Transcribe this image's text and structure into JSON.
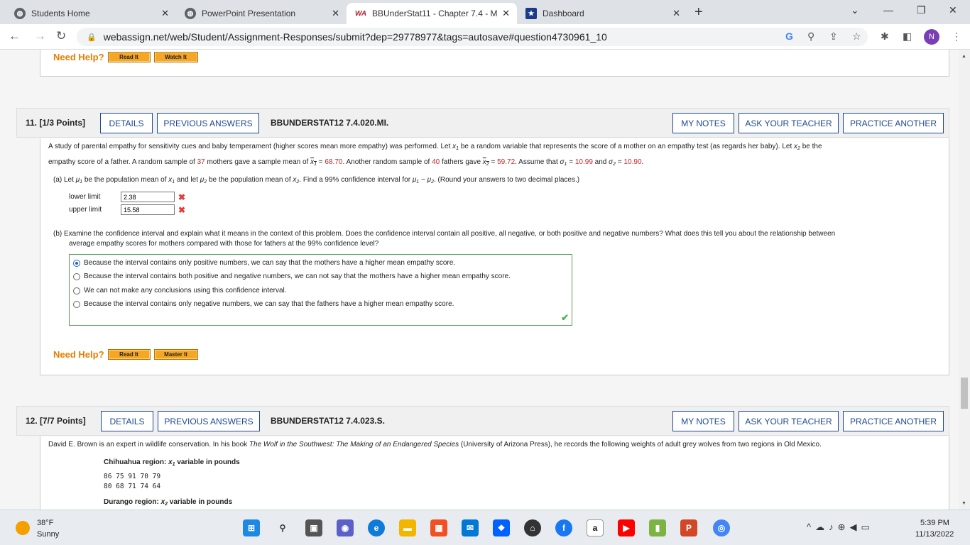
{
  "browser": {
    "tabs": [
      {
        "title": "Students Home",
        "active": false
      },
      {
        "title": "PowerPoint Presentation",
        "active": false
      },
      {
        "title": "BBUnderStat11 - Chapter 7.4 - M",
        "active": true
      },
      {
        "title": "Dashboard",
        "active": false
      }
    ],
    "url": "webassign.net/web/Student/Assignment-Responses/submit?dep=29778977&tags=autosave#question4730961_10",
    "profile_initial": "N"
  },
  "help": {
    "need_help": "Need Help?",
    "read_it": "Read It",
    "watch_it": "Watch It",
    "master_it": "Master It"
  },
  "q11": {
    "number": "11. [1/3 Points]",
    "details": "DETAILS",
    "previous": "PREVIOUS ANSWERS",
    "code": "BBUNDERSTAT12 7.4.020.MI.",
    "my_notes": "MY NOTES",
    "ask_teacher": "ASK YOUR TEACHER",
    "practice": "PRACTICE ANOTHER",
    "intro_a": "A study of parental empathy for sensitivity cues and baby temperament (higher scores mean more empathy) was performed. Let ",
    "intro_b": " be a random variable that represents the score of a mother on an empathy test (as regards her baby). Let ",
    "intro_c": " be the",
    "intro2_a": "empathy score of a father. A random sample of ",
    "mothers_n": "37",
    "intro2_b": " mothers gave a sample mean of ",
    "x1bar": "68.70",
    "intro2_c": ". Another random sample of ",
    "fathers_n": "40",
    "intro2_d": " fathers gave ",
    "x2bar": "59.72",
    "intro2_e": ". Assume that ",
    "sigma1": "10.99",
    "sigma2": "10.90",
    "part_a_a": "(a)  Let ",
    "part_a_b": " be the population mean of ",
    "part_a_c": " and let ",
    "part_a_d": " be the population mean of ",
    "part_a_e": ". Find a 99% confidence interval for ",
    "part_a_f": ". (Round your answers to two decimal places.)",
    "lower_label": "lower limit",
    "lower_value": "2.38",
    "upper_label": "upper limit",
    "upper_value": "15.58",
    "part_b_1": "(b)  Examine the confidence interval and explain what it means in the context of this problem. Does the confidence interval contain all positive, all negative, or both positive and negative numbers? What does this tell you about the relationship between",
    "part_b_2": "average empathy scores for mothers compared with those for fathers at the 99% confidence level?",
    "options": [
      {
        "label": "Because the interval contains only positive numbers, we can say that the mothers have a higher mean empathy score.",
        "selected": true
      },
      {
        "label": "Because the interval contains both positive and negative numbers, we can not say that the mothers have a higher mean empathy score.",
        "selected": false
      },
      {
        "label": "We can not make any conclusions using this confidence interval.",
        "selected": false
      },
      {
        "label": "Because the interval contains only negative numbers, we can say that the fathers have a higher mean empathy score.",
        "selected": false
      }
    ]
  },
  "q12": {
    "number": "12. [7/7 Points]",
    "details": "DETAILS",
    "previous": "PREVIOUS ANSWERS",
    "code": "BBUNDERSTAT12 7.4.023.S.",
    "my_notes": "MY NOTES",
    "ask_teacher": "ASK YOUR TEACHER",
    "practice": "PRACTICE ANOTHER",
    "intro_a": "David E. Brown is an expert in wildlife conservation. In his book ",
    "book": "The Wolf in the Southwest: The Making of an Endangered Species",
    "intro_b": " (University of Arizona Press), he records the following weights of adult grey wolves from two regions in Old Mexico.",
    "chihuahua_a": "Chihuahua region: ",
    "chihuahua_b": " variable in pounds",
    "row1": "86  75  91  70  79",
    "row2": "80  68  71  74  64",
    "durango_a": "Durango region: ",
    "durango_b": " variable in pounds"
  },
  "taskbar": {
    "temp": "38°F",
    "weather": "Sunny",
    "time": "5:39 PM",
    "date": "11/13/2022"
  }
}
